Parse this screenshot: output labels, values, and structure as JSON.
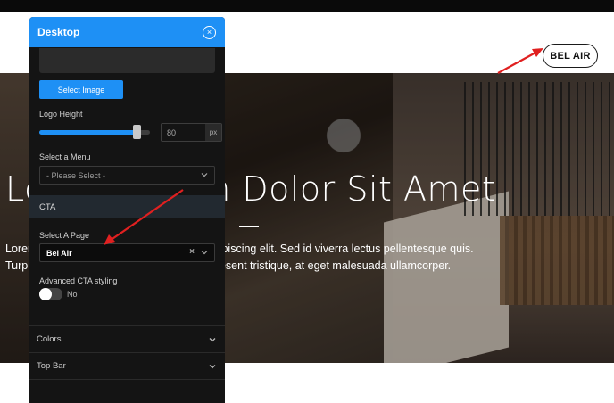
{
  "site": {
    "cta_button": "BEL AIR",
    "hero_title": "Lorem Ipsum Dolor Sit Amet",
    "hero_line1": "Lorem ipsum dolor sit amet, consectetur adipiscing elit. Sed id viverra lectus pellentesque quis.",
    "hero_line2": "Turpis egestas integer eget aliquet nibh praesent tristique, at eget malesuada ullamcorper."
  },
  "panel": {
    "title": "Desktop",
    "close_icon": "×",
    "select_image_label": "Select Image",
    "logo_height_label": "Logo Height",
    "logo_height_value": "80",
    "logo_height_percent": 0.88,
    "logo_height_unit": "px",
    "menu_label": "Select a Menu",
    "menu_placeholder": "- Please Select -",
    "cta_section": "CTA",
    "page_label": "Select A Page",
    "page_value": "Bel Air",
    "clear_icon": "×",
    "advanced_label": "Advanced CTA styling",
    "advanced_toggle_text": "No",
    "accordion": [
      {
        "label": "Colors"
      },
      {
        "label": "Top Bar"
      }
    ]
  },
  "colors": {
    "accent": "#1e90f5",
    "arrow": "#e02020"
  }
}
